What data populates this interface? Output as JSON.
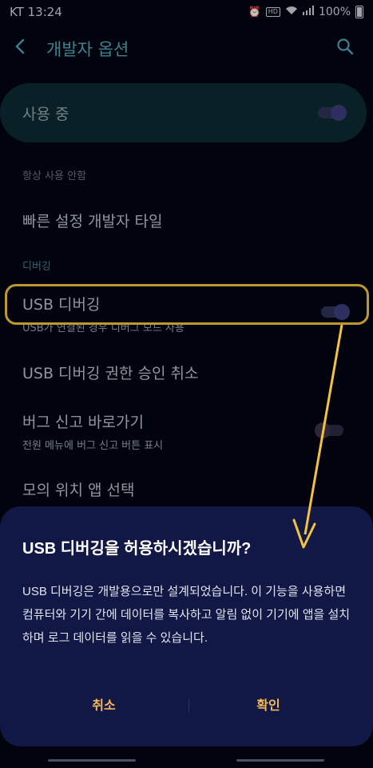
{
  "statusbar": {
    "carrier_time": "KT 13:24",
    "battery": "100%",
    "hd": "HD"
  },
  "header": {
    "title": "개발자 옵션"
  },
  "master": {
    "label": "사용 중"
  },
  "items": {
    "always_on": "항상 사용 안함",
    "quick_tiles": "빠른 설정 개발자 타일",
    "section_debugging": "디버깅",
    "usb_debugging": {
      "title": "USB 디버깅",
      "subtitle": "USB가 연결된 경우 디버그 모드 사용"
    },
    "revoke_usb": "USB 디버깅 권한 승인 취소",
    "bug_report": {
      "title": "버그 신고 바로가기",
      "subtitle": "전원 메뉴에 버그 신고 버튼 표시"
    },
    "mock_location": {
      "title": "모의 위치 앱 선택"
    }
  },
  "dialog": {
    "title": "USB 디버깅을 허용하시겠습니까?",
    "body": "USB 디버깅은 개발용으로만 설계되었습니다. 이 기능을 사용하면 컴퓨터와 기기 간에 데이터를 복사하고 알림 없이 기기에 앱을 설치하며 로그 데이터를 읽을 수 있습니다.",
    "cancel": "취소",
    "confirm": "확인"
  },
  "colors": {
    "highlight": "#f4c33d",
    "accent": "#4fa6b8",
    "dialog_button": "#f2b85a"
  }
}
